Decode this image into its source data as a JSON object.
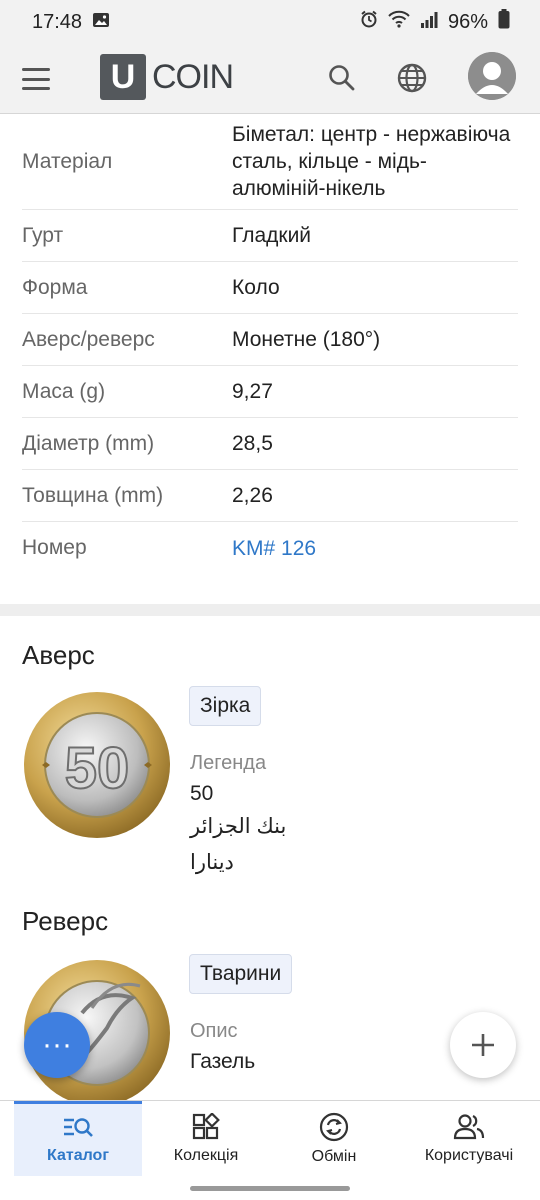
{
  "status": {
    "time": "17:48",
    "battery": "96%"
  },
  "app": {
    "logo_letter": "U",
    "logo_text": "COIN"
  },
  "specs": [
    {
      "label": "Матеріал",
      "value": "Біметал: центр - нержавіюча сталь, кільце - мідь-алюміній-нікель"
    },
    {
      "label": "Гурт",
      "value": "Гладкий"
    },
    {
      "label": "Форма",
      "value": "Коло"
    },
    {
      "label": "Аверс/реверс",
      "value": "Монетне (180°)"
    },
    {
      "label": "Маса (g)",
      "value": "9,27"
    },
    {
      "label": "Діаметр (mm)",
      "value": "28,5"
    },
    {
      "label": "Товщина (mm)",
      "value": "2,26"
    },
    {
      "label": "Номер",
      "value": "KM# 126"
    }
  ],
  "obverse": {
    "title": "Аверс",
    "chip": "Зірка",
    "legend_label": "Легенда",
    "legend_lines": [
      "50",
      "بنك الجزائر",
      "دينارا"
    ],
    "coin_numeral": "50"
  },
  "reverse": {
    "title": "Реверс",
    "chip": "Тварини",
    "desc_label": "Опис",
    "desc_text": "Газель"
  },
  "fab": {
    "more": "···",
    "add": "+"
  },
  "nav": [
    {
      "label": "Каталог",
      "icon": "catalog-search-icon"
    },
    {
      "label": "Колекція",
      "icon": "collection-grid-icon"
    },
    {
      "label": "Обмін",
      "icon": "exchange-sync-icon"
    },
    {
      "label": "Користувачі",
      "icon": "users-icon"
    }
  ],
  "colors": {
    "accent": "#3f7fe0",
    "link": "#2f78c8",
    "chip_bg": "#eef2fb"
  }
}
